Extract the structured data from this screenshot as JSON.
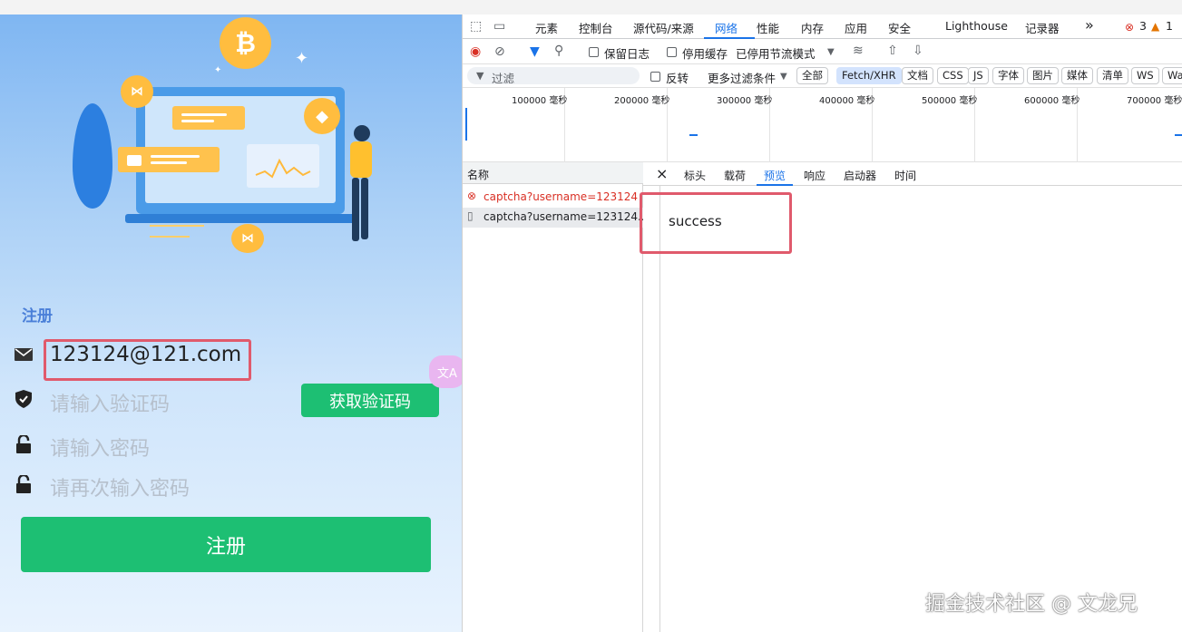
{
  "app": {
    "section_title": "注册",
    "email_value": "123124@121.com",
    "code_placeholder": "请输入验证码",
    "get_code_label": "获取验证码",
    "password_placeholder": "请输入密码",
    "confirm_password_placeholder": "请再次输入密码",
    "register_label": "注册",
    "translate_badge": "文A",
    "colors": {
      "accent_green": "#1dbf73",
      "highlight_red": "#e05a6c",
      "title_blue": "#4a7fd8"
    },
    "icons": [
      "mail-icon",
      "shield-check-icon",
      "lock-icon",
      "lock-icon",
      "bitcoin-icon",
      "ethereum-icon"
    ]
  },
  "devtools": {
    "tabs": [
      "元素",
      "控制台",
      "源代码/来源",
      "网络",
      "性能",
      "内存",
      "应用",
      "安全",
      "Lighthouse",
      "记录器"
    ],
    "active_tab": "网络",
    "more_tabs": "»",
    "error_count": "3",
    "warning_count": "1",
    "toolbar": {
      "preserve_log": "保留日志",
      "disable_cache": "停用缓存",
      "throttling": "已停用节流模式"
    },
    "filter": {
      "placeholder": "过滤",
      "invert": "反转",
      "more_filters": "更多过滤条件",
      "types": [
        "全部",
        "Fetch/XHR",
        "文档",
        "CSS",
        "JS",
        "字体",
        "图片",
        "媒体",
        "清单",
        "WS",
        "Wa"
      ],
      "selected_type": "Fetch/XHR"
    },
    "timeline_ticks": [
      "100000 毫秒",
      "200000 毫秒",
      "300000 毫秒",
      "400000 毫秒",
      "500000 毫秒",
      "600000 毫秒",
      "700000 毫秒"
    ],
    "requests": {
      "header": "名称",
      "rows": [
        {
          "name": "captcha?username=123124",
          "status": "error"
        },
        {
          "name": "captcha?username=123124...",
          "status": "selected"
        }
      ]
    },
    "detail": {
      "close": "×",
      "tabs": [
        "标头",
        "载荷",
        "预览",
        "响应",
        "启动器",
        "时间"
      ],
      "active_tab": "预览",
      "preview_body": "success"
    }
  },
  "watermark": "掘金技术社区 @ 文龙兄"
}
